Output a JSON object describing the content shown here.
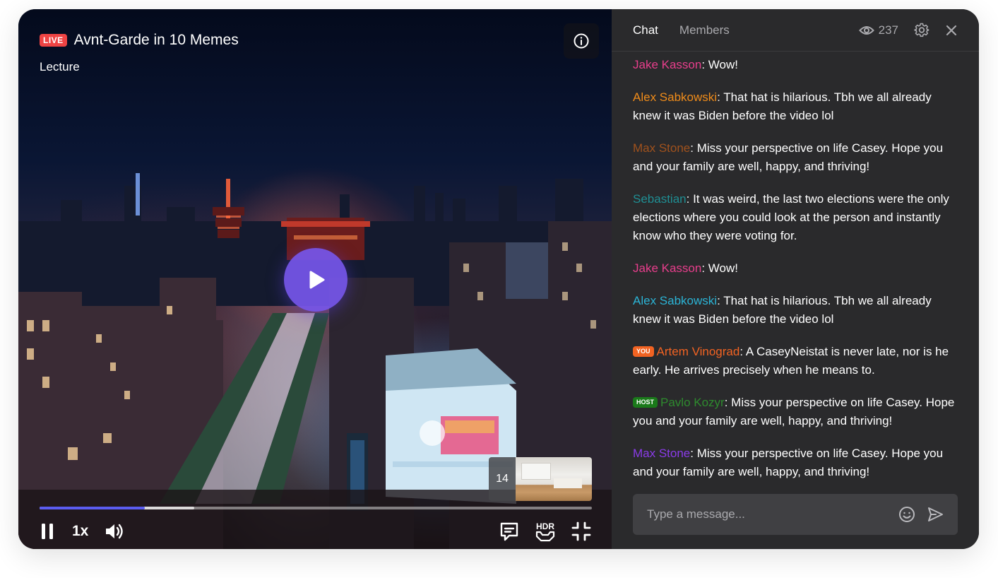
{
  "video": {
    "live_label": "LIVE",
    "title": "Avnt-Garde in 10 Memes",
    "subtitle": "Lecture",
    "progress_percent": 19,
    "buffered_percent": 28,
    "speed_label": "1x",
    "hdr_label": "HDR",
    "preview_count": "14",
    "icons": {
      "info": "info-icon",
      "play": "play-icon",
      "pause": "pause-icon",
      "volume": "volume-icon",
      "chat_toggle": "chat-bubble-icon",
      "hdr": "hdr-icon",
      "exit_fullscreen": "exit-fullscreen-icon"
    },
    "colors": {
      "accent": "#5b5cf0",
      "play_button": "#7656eb",
      "live": "#ef4444"
    }
  },
  "chat": {
    "tabs": [
      {
        "label": "Chat",
        "active": true
      },
      {
        "label": "Members",
        "active": false
      }
    ],
    "viewer_count": "237",
    "icons": {
      "viewers": "eye-icon",
      "settings": "gear-icon",
      "close": "close-icon"
    },
    "messages": [
      {
        "author": "Jake Kasson",
        "color": "#e83e8c",
        "tag": null,
        "text": ": Wow!"
      },
      {
        "author": "Alex Sabkowski",
        "color": "#f08c1a",
        "tag": null,
        "text": ": That hat is hilarious. Tbh we all already knew it was Biden before the video lol"
      },
      {
        "author": "Max Stone",
        "color": "#a0521d",
        "tag": null,
        "text": ": Miss your perspective on life Casey.  Hope you and your family are well, happy, and thriving!"
      },
      {
        "author": "Sebastian",
        "color": "#1f8f94",
        "tag": null,
        "text": ": It was weird, the last two elections were the only elections where you could look at the person and instantly know who they were voting for."
      },
      {
        "author": "Jake Kasson",
        "color": "#e83e8c",
        "tag": null,
        "text": ": Wow!"
      },
      {
        "author": "Alex Sabkowski",
        "color": "#2bb4d6",
        "tag": null,
        "text": ": That hat is hilarious. Tbh we all already knew it was Biden before the video lol"
      },
      {
        "author": "Artem Vinograd",
        "color": "#f26322",
        "tag": {
          "label": "YOU",
          "color": "#f26322"
        },
        "text": ": A CaseyNeistat is never late, nor is he early. He arrives precisely when he means to."
      },
      {
        "author": "Pavlo Kozyr",
        "color": "#2e8b2e",
        "tag": {
          "label": "HOST",
          "color": "#1a7a1a"
        },
        "text": ": Miss your perspective on life Casey.  Hope you and your family are well, happy, and thriving!"
      },
      {
        "author": "Max Stone",
        "color": "#8a3be8",
        "tag": null,
        "text": ": Miss your perspective on life Casey.  Hope you and your family are well, happy, and thriving!"
      }
    ],
    "composer": {
      "placeholder": "Type a message...",
      "icons": {
        "emoji": "emoji-icon",
        "send": "send-icon"
      }
    }
  }
}
